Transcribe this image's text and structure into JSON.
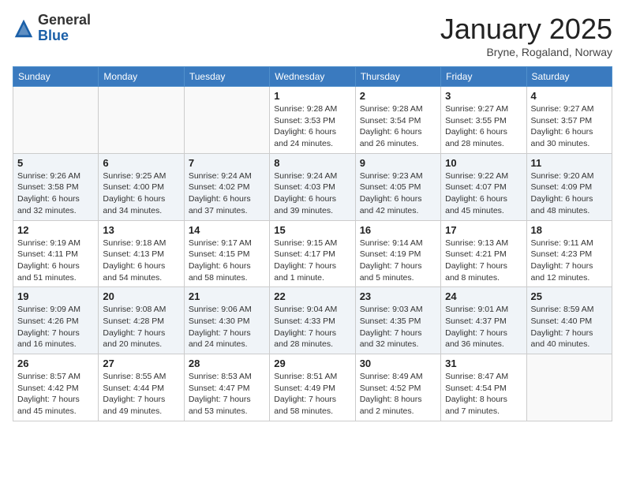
{
  "header": {
    "logo_general": "General",
    "logo_blue": "Blue",
    "month_title": "January 2025",
    "subtitle": "Bryne, Rogaland, Norway"
  },
  "weekdays": [
    "Sunday",
    "Monday",
    "Tuesday",
    "Wednesday",
    "Thursday",
    "Friday",
    "Saturday"
  ],
  "weeks": [
    [
      {
        "day": "",
        "info": ""
      },
      {
        "day": "",
        "info": ""
      },
      {
        "day": "",
        "info": ""
      },
      {
        "day": "1",
        "info": "Sunrise: 9:28 AM\nSunset: 3:53 PM\nDaylight: 6 hours and 24 minutes."
      },
      {
        "day": "2",
        "info": "Sunrise: 9:28 AM\nSunset: 3:54 PM\nDaylight: 6 hours and 26 minutes."
      },
      {
        "day": "3",
        "info": "Sunrise: 9:27 AM\nSunset: 3:55 PM\nDaylight: 6 hours and 28 minutes."
      },
      {
        "day": "4",
        "info": "Sunrise: 9:27 AM\nSunset: 3:57 PM\nDaylight: 6 hours and 30 minutes."
      }
    ],
    [
      {
        "day": "5",
        "info": "Sunrise: 9:26 AM\nSunset: 3:58 PM\nDaylight: 6 hours and 32 minutes."
      },
      {
        "day": "6",
        "info": "Sunrise: 9:25 AM\nSunset: 4:00 PM\nDaylight: 6 hours and 34 minutes."
      },
      {
        "day": "7",
        "info": "Sunrise: 9:24 AM\nSunset: 4:02 PM\nDaylight: 6 hours and 37 minutes."
      },
      {
        "day": "8",
        "info": "Sunrise: 9:24 AM\nSunset: 4:03 PM\nDaylight: 6 hours and 39 minutes."
      },
      {
        "day": "9",
        "info": "Sunrise: 9:23 AM\nSunset: 4:05 PM\nDaylight: 6 hours and 42 minutes."
      },
      {
        "day": "10",
        "info": "Sunrise: 9:22 AM\nSunset: 4:07 PM\nDaylight: 6 hours and 45 minutes."
      },
      {
        "day": "11",
        "info": "Sunrise: 9:20 AM\nSunset: 4:09 PM\nDaylight: 6 hours and 48 minutes."
      }
    ],
    [
      {
        "day": "12",
        "info": "Sunrise: 9:19 AM\nSunset: 4:11 PM\nDaylight: 6 hours and 51 minutes."
      },
      {
        "day": "13",
        "info": "Sunrise: 9:18 AM\nSunset: 4:13 PM\nDaylight: 6 hours and 54 minutes."
      },
      {
        "day": "14",
        "info": "Sunrise: 9:17 AM\nSunset: 4:15 PM\nDaylight: 6 hours and 58 minutes."
      },
      {
        "day": "15",
        "info": "Sunrise: 9:15 AM\nSunset: 4:17 PM\nDaylight: 7 hours and 1 minute."
      },
      {
        "day": "16",
        "info": "Sunrise: 9:14 AM\nSunset: 4:19 PM\nDaylight: 7 hours and 5 minutes."
      },
      {
        "day": "17",
        "info": "Sunrise: 9:13 AM\nSunset: 4:21 PM\nDaylight: 7 hours and 8 minutes."
      },
      {
        "day": "18",
        "info": "Sunrise: 9:11 AM\nSunset: 4:23 PM\nDaylight: 7 hours and 12 minutes."
      }
    ],
    [
      {
        "day": "19",
        "info": "Sunrise: 9:09 AM\nSunset: 4:26 PM\nDaylight: 7 hours and 16 minutes."
      },
      {
        "day": "20",
        "info": "Sunrise: 9:08 AM\nSunset: 4:28 PM\nDaylight: 7 hours and 20 minutes."
      },
      {
        "day": "21",
        "info": "Sunrise: 9:06 AM\nSunset: 4:30 PM\nDaylight: 7 hours and 24 minutes."
      },
      {
        "day": "22",
        "info": "Sunrise: 9:04 AM\nSunset: 4:33 PM\nDaylight: 7 hours and 28 minutes."
      },
      {
        "day": "23",
        "info": "Sunrise: 9:03 AM\nSunset: 4:35 PM\nDaylight: 7 hours and 32 minutes."
      },
      {
        "day": "24",
        "info": "Sunrise: 9:01 AM\nSunset: 4:37 PM\nDaylight: 7 hours and 36 minutes."
      },
      {
        "day": "25",
        "info": "Sunrise: 8:59 AM\nSunset: 4:40 PM\nDaylight: 7 hours and 40 minutes."
      }
    ],
    [
      {
        "day": "26",
        "info": "Sunrise: 8:57 AM\nSunset: 4:42 PM\nDaylight: 7 hours and 45 minutes."
      },
      {
        "day": "27",
        "info": "Sunrise: 8:55 AM\nSunset: 4:44 PM\nDaylight: 7 hours and 49 minutes."
      },
      {
        "day": "28",
        "info": "Sunrise: 8:53 AM\nSunset: 4:47 PM\nDaylight: 7 hours and 53 minutes."
      },
      {
        "day": "29",
        "info": "Sunrise: 8:51 AM\nSunset: 4:49 PM\nDaylight: 7 hours and 58 minutes."
      },
      {
        "day": "30",
        "info": "Sunrise: 8:49 AM\nSunset: 4:52 PM\nDaylight: 8 hours and 2 minutes."
      },
      {
        "day": "31",
        "info": "Sunrise: 8:47 AM\nSunset: 4:54 PM\nDaylight: 8 hours and 7 minutes."
      },
      {
        "day": "",
        "info": ""
      }
    ]
  ]
}
